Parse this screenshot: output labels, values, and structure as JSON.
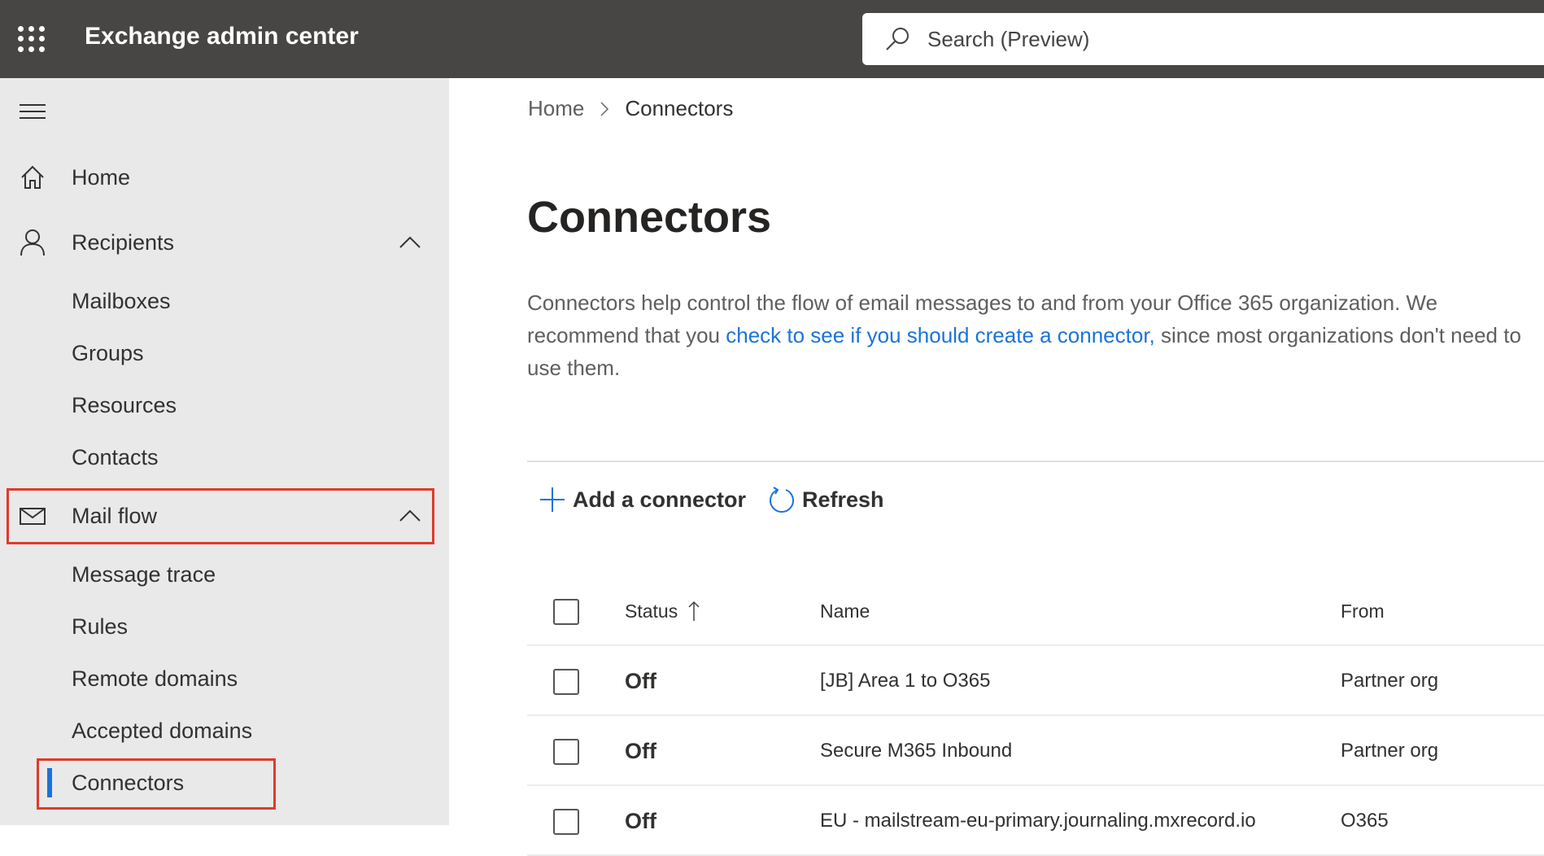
{
  "app": {
    "title": "Exchange admin center",
    "search_placeholder": "Search (Preview)"
  },
  "sidebar": {
    "items": [
      {
        "label": "Home",
        "icon": "home-icon"
      },
      {
        "label": "Recipients",
        "icon": "person-icon",
        "expanded": true
      },
      {
        "label": "Mailboxes"
      },
      {
        "label": "Groups"
      },
      {
        "label": "Resources"
      },
      {
        "label": "Contacts"
      },
      {
        "label": "Mail flow",
        "icon": "mail-icon",
        "expanded": true
      },
      {
        "label": "Message trace"
      },
      {
        "label": "Rules"
      },
      {
        "label": "Remote domains"
      },
      {
        "label": "Accepted domains"
      },
      {
        "label": "Connectors",
        "selected": true
      }
    ]
  },
  "breadcrumb": {
    "home": "Home",
    "current": "Connectors"
  },
  "main": {
    "title": "Connectors",
    "desc_before": "Connectors help control the flow of email messages to and from your Office 365 organization. We recommend that you ",
    "desc_link": "check to see if you should create a connector,",
    "desc_after": " since most organizations don't need to use them.",
    "toolbar": {
      "add": "Add a connector",
      "refresh": "Refresh"
    },
    "table": {
      "headers": {
        "status": "Status",
        "name": "Name",
        "from": "From"
      },
      "rows": [
        {
          "status": "Off",
          "name": "[JB] Area 1 to O365",
          "from": "Partner org"
        },
        {
          "status": "Off",
          "name": "Secure M365 Inbound",
          "from": "Partner org"
        },
        {
          "status": "Off",
          "name": "EU - mailstream-eu-primary.journaling.mxrecord.io",
          "from": "O365"
        }
      ]
    }
  },
  "colors": {
    "accent": "#1a73d9",
    "topbar": "#484644",
    "highlight": "#e03a2a"
  }
}
